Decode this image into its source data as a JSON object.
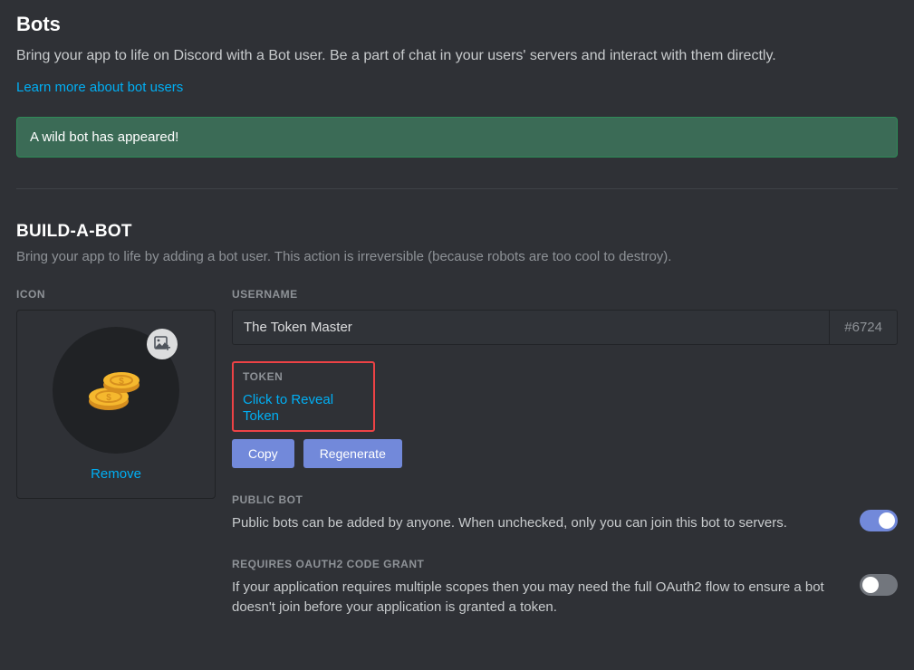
{
  "header": {
    "title": "Bots",
    "subtitle": "Bring your app to life on Discord with a Bot user. Be a part of chat in your users' servers and interact with them directly.",
    "learn_more": "Learn more about bot users"
  },
  "alert": {
    "text": "A wild bot has appeared!"
  },
  "build": {
    "title": "BUILD-A-BOT",
    "subtitle": "Bring your app to life by adding a bot user. This action is irreversible (because robots are too cool to destroy)."
  },
  "icon": {
    "label": "ICON",
    "remove": "Remove"
  },
  "username": {
    "label": "USERNAME",
    "value": "The Token Master",
    "discriminator": "#6724"
  },
  "token": {
    "label": "TOKEN",
    "reveal": "Click to Reveal Token",
    "copy": "Copy",
    "regenerate": "Regenerate"
  },
  "public_bot": {
    "title": "PUBLIC BOT",
    "desc": "Public bots can be added by anyone. When unchecked, only you can join this bot to servers.",
    "enabled": true
  },
  "oauth2": {
    "title": "REQUIRES OAUTH2 CODE GRANT",
    "desc": "If your application requires multiple scopes then you may need the full OAuth2 flow to ensure a bot doesn't join before your application is granted a token.",
    "enabled": false
  }
}
